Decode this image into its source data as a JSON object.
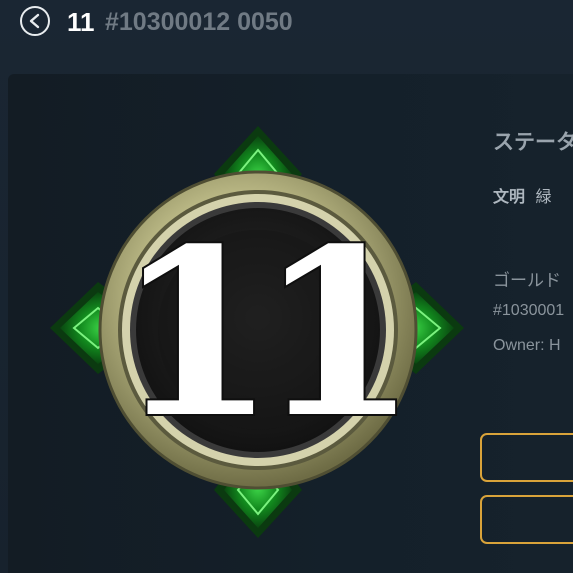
{
  "header": {
    "back_icon": "chevron-left-icon",
    "title_number": "11",
    "title_id": "#10300012 0050"
  },
  "badge": {
    "number": "11",
    "ring_color": "#c8c79a",
    "gem_color": "#1f9a2c"
  },
  "info": {
    "status_title": "ステータ",
    "civ_label": "文明",
    "civ_value": "緑",
    "gold_label": "ゴールド",
    "token_id": "#1030001",
    "owner": "Owner: H"
  },
  "buttons": {
    "accent_color": "#d9a33a"
  }
}
